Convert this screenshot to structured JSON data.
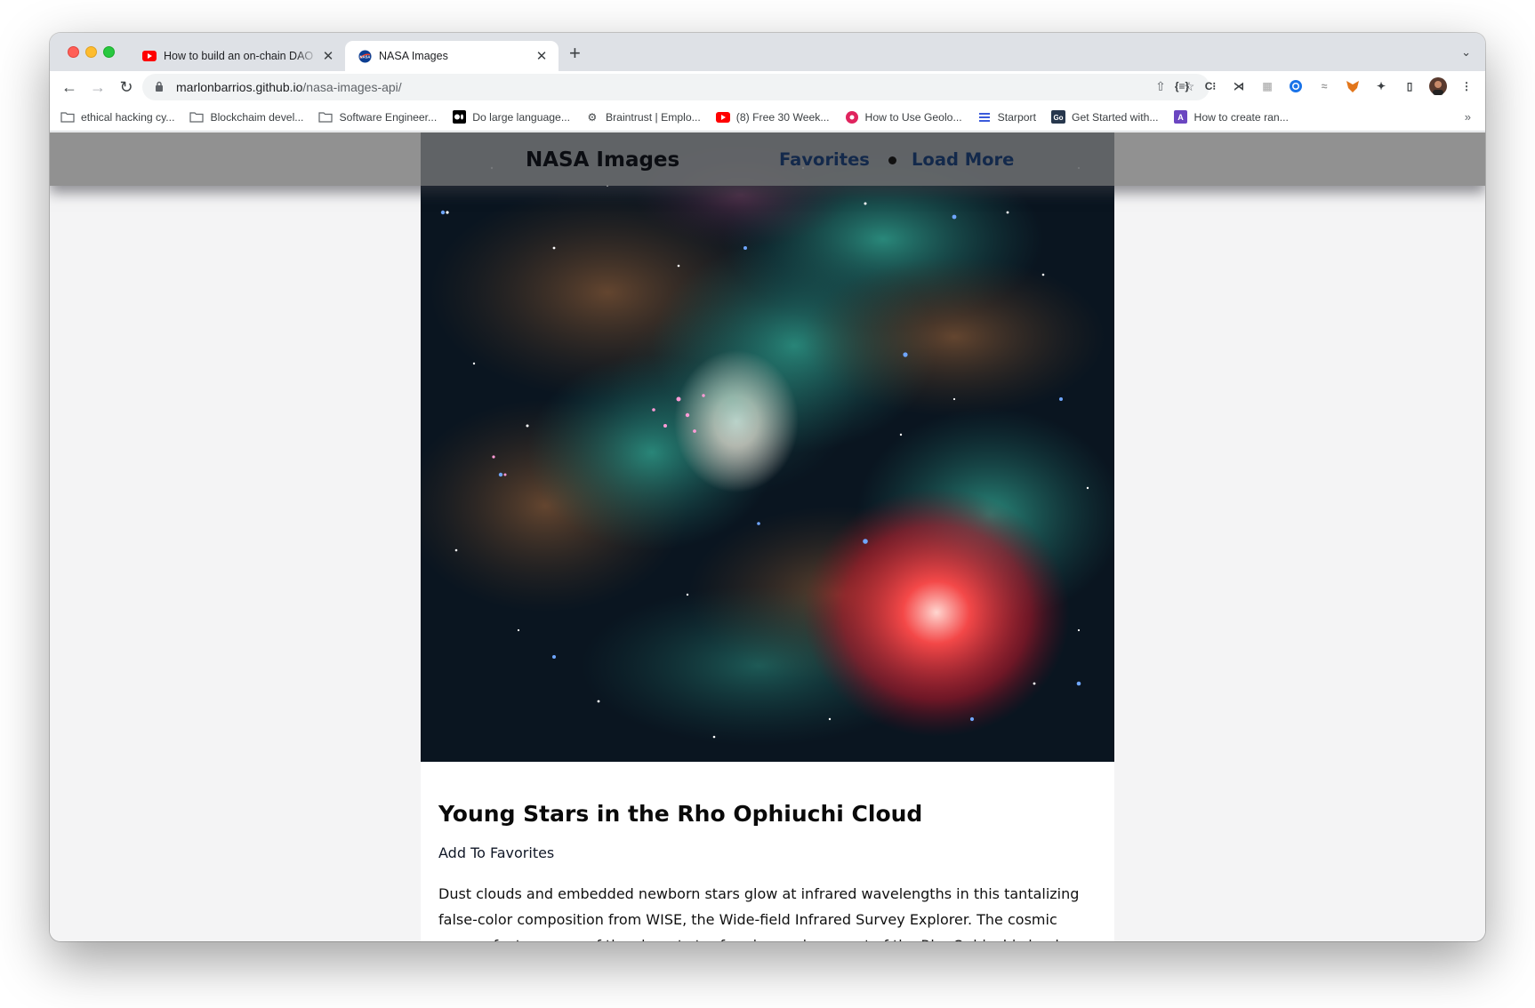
{
  "browser": {
    "tabs": [
      {
        "title": "How to build an on-chain DAO",
        "active": false,
        "favicon": "youtube-icon"
      },
      {
        "title": "NASA Images",
        "active": true,
        "favicon": "nasa-icon"
      }
    ],
    "url_host": "marlonbarrios.github.io",
    "url_path": "/nasa-images-api/",
    "bookmarks": [
      {
        "label": "ethical hacking cy...",
        "icon": "folder-icon"
      },
      {
        "label": "Blockchaim devel...",
        "icon": "folder-icon"
      },
      {
        "label": "Software Engineer...",
        "icon": "folder-icon"
      },
      {
        "label": "Do large language...",
        "icon": "medium-icon"
      },
      {
        "label": "Braintrust | Emplo...",
        "icon": "gear-icon"
      },
      {
        "label": "(8) Free 30 Week...",
        "icon": "youtube-icon"
      },
      {
        "label": "How to Use Geolo...",
        "icon": "red-circle-icon"
      },
      {
        "label": "Starport",
        "icon": "starport-icon"
      },
      {
        "label": "Get Started with...",
        "icon": "go-icon"
      },
      {
        "label": "How to create ran...",
        "icon": "purple-a-icon"
      }
    ]
  },
  "site": {
    "title": "NASA Images",
    "nav_favorites": "Favorites",
    "nav_load_more": "Load More"
  },
  "card": {
    "title": "Young Stars in the Rho Ophiuchi Cloud",
    "favorite_button": "Add To Favorites",
    "description": "Dust clouds and embedded newborn stars glow at infrared wavelengths in this tantalizing false-color composition from WISE, the Wide-field Infrared Survey Explorer. The cosmic canvas features one of the closest star forming regions, part of the Rho Ophiuchi cloud"
  }
}
